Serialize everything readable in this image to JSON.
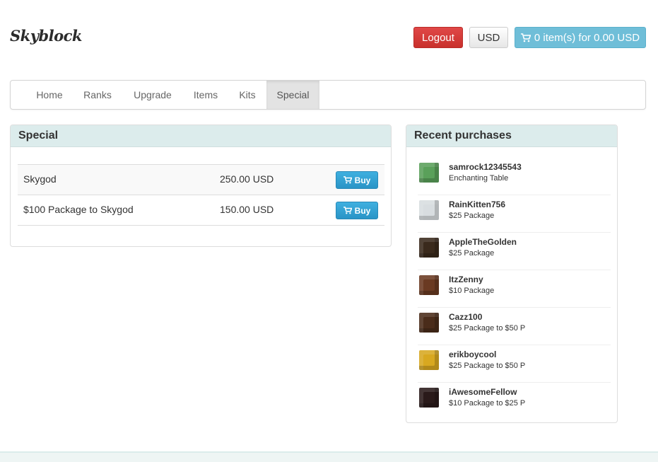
{
  "brand": {
    "logo": "Skyblock"
  },
  "header": {
    "logout_label": "Logout",
    "currency_label": "USD",
    "cart_label": "0 item(s) for 0.00 USD"
  },
  "nav": {
    "items": [
      {
        "label": "Home"
      },
      {
        "label": "Ranks"
      },
      {
        "label": "Upgrade"
      },
      {
        "label": "Items"
      },
      {
        "label": "Kits"
      },
      {
        "label": "Special"
      }
    ],
    "active": "Special"
  },
  "special": {
    "title": "Special",
    "packages": [
      {
        "name": "Skygod",
        "price": "250.00 USD",
        "buy_label": "Buy"
      },
      {
        "name": "$100 Package to Skygod",
        "price": "150.00 USD",
        "buy_label": "Buy"
      }
    ]
  },
  "recent": {
    "title": "Recent purchases",
    "items": [
      {
        "user": "samrock12345543",
        "package": "Enchanting Table",
        "avatar_color": "#5aa05a"
      },
      {
        "user": "RainKitten756",
        "package": "$25 Package",
        "avatar_color": "#d8dde0"
      },
      {
        "user": "AppleTheGolden",
        "package": "$25 Package",
        "avatar_color": "#3a2a1c"
      },
      {
        "user": "ItzZenny",
        "package": "$10 Package",
        "avatar_color": "#6a3a22"
      },
      {
        "user": "Cazz100",
        "package": "$25 Package to $50 P",
        "avatar_color": "#4a2c1a"
      },
      {
        "user": "erikboycool",
        "package": "$25 Package to $50 P",
        "avatar_color": "#d8a820"
      },
      {
        "user": "iAwesomeFellow",
        "package": "$10 Package to $25 P",
        "avatar_color": "#2a1a1a"
      }
    ]
  },
  "colors": {
    "danger": "#d9534f",
    "info": "#6fbed8",
    "buy": "#2a94c6",
    "panel_head": "#dcecec"
  }
}
